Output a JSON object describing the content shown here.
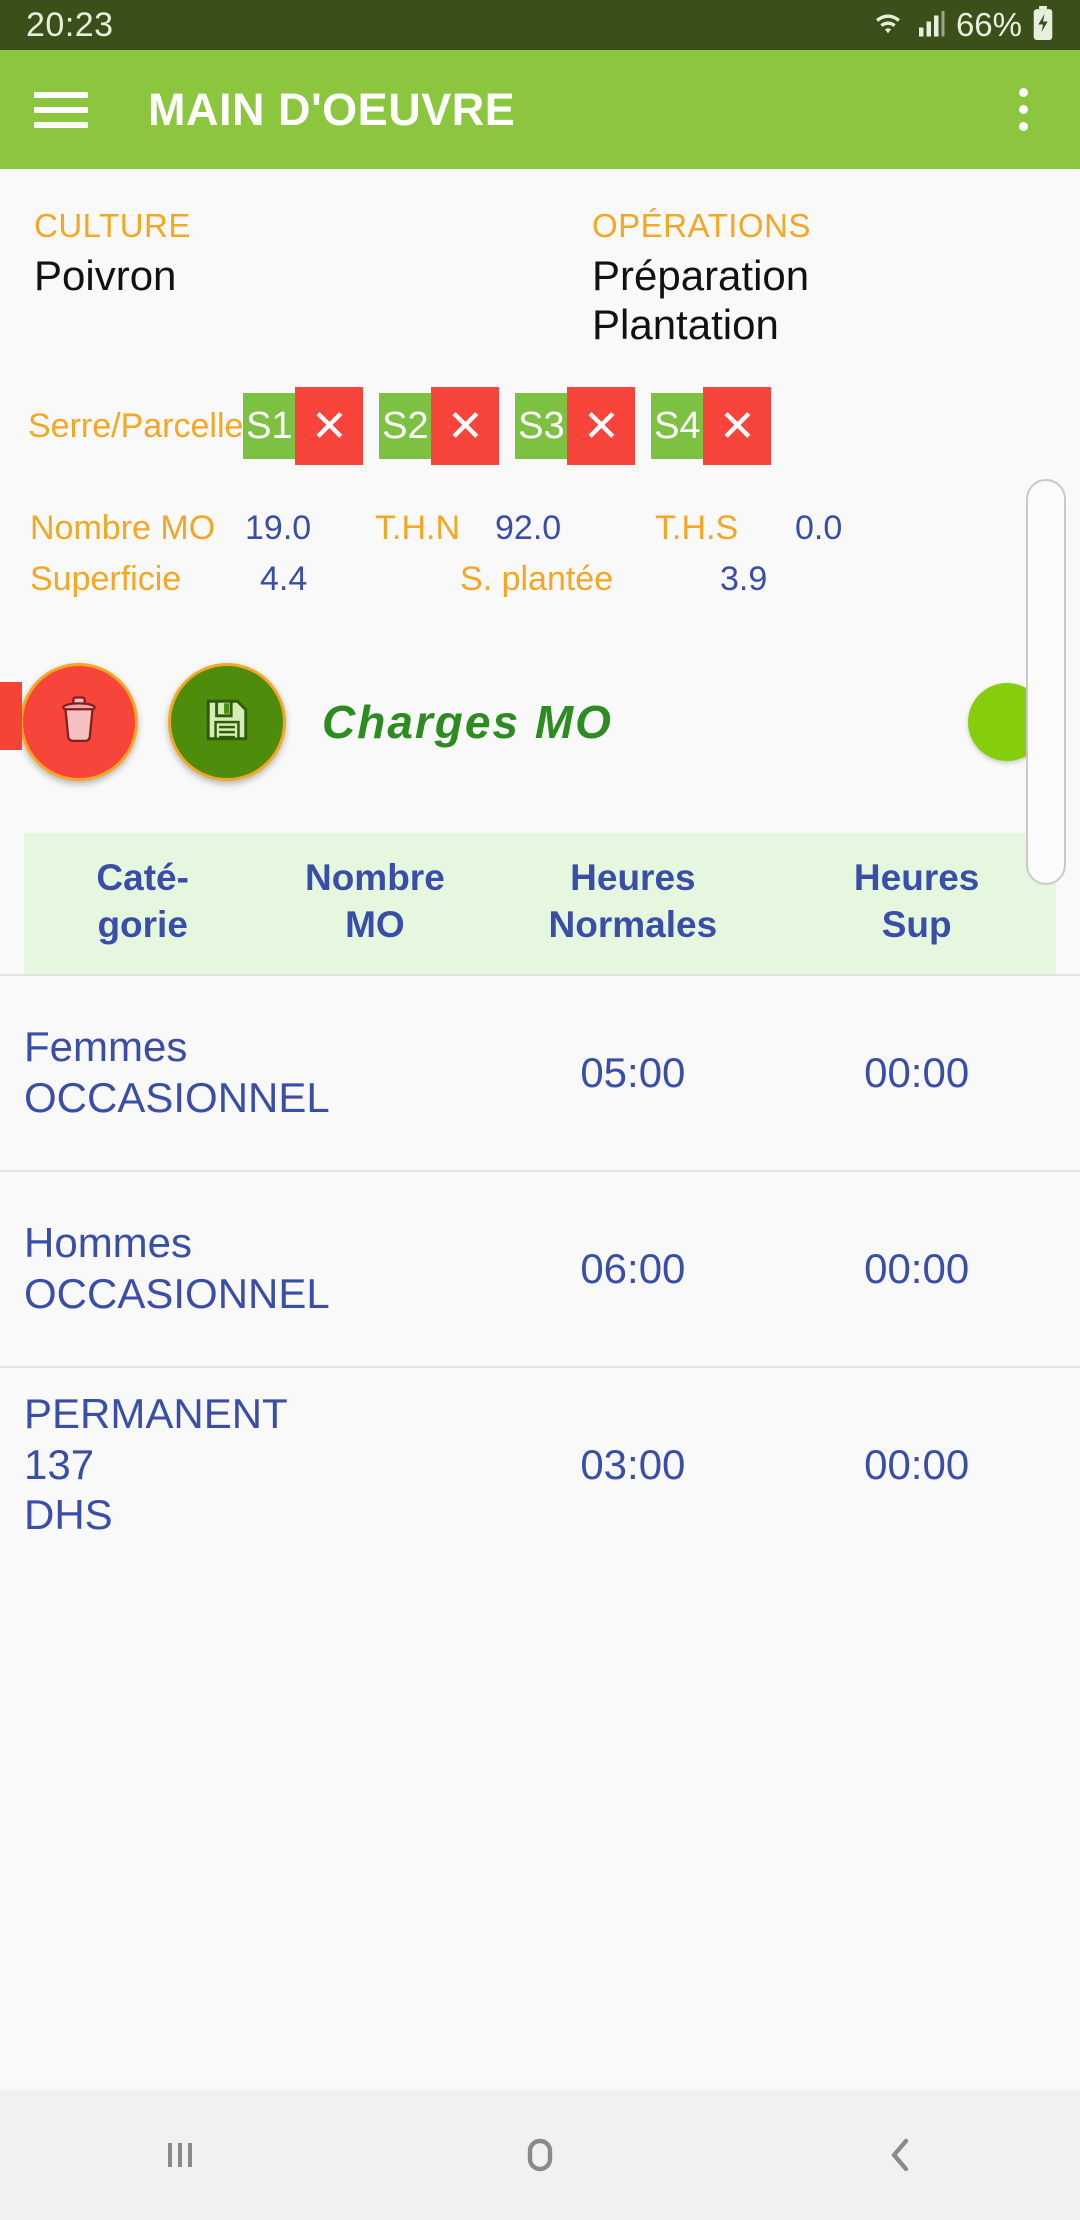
{
  "status_bar": {
    "clock": "20:23",
    "battery_percent": "66%",
    "icons": [
      "wifi-icon",
      "signal-icon",
      "battery-charging-icon"
    ]
  },
  "app_bar": {
    "title": "MAIN D'OEUVRE",
    "menu_icon": "hamburger-menu-icon",
    "overflow_icon": "kebab-menu-icon"
  },
  "info": {
    "culture_label": "CULTURE",
    "culture_value": "Poivron",
    "operations_label": "OPÉRATIONS",
    "operations_value": "Préparation\nPlantation"
  },
  "parcelle": {
    "label": "Serre/Parcelle",
    "remove_glyph": "✕",
    "chips": [
      {
        "name": "S1"
      },
      {
        "name": "S2"
      },
      {
        "name": "S3"
      },
      {
        "name": "S4"
      }
    ]
  },
  "stats": {
    "nombre_mo_label": "Nombre MO",
    "nombre_mo_value": "19.0",
    "thn_label": "T.H.N",
    "thn_value": "92.0",
    "ths_label": "T.H.S",
    "ths_value": "0.0",
    "superficie_label": "Superficie",
    "superficie_value": "4.4",
    "s_plantee_label": "S. plantée",
    "s_plantee_value": "3.9"
  },
  "actions": {
    "delete_icon": "trash-icon",
    "save_icon": "floppy-disk-save-icon",
    "section_title": "Charges MO",
    "add_icon": "add-circle-icon"
  },
  "table": {
    "headers": {
      "categorie": "Caté-\ngorie",
      "nombre_mo": "Nombre\nMO",
      "heures_normales": "Heures\nNormales",
      "heures_sup": "Heures\nSup"
    },
    "rows": [
      {
        "categorie": "Femmes\nOCCASIONNEL",
        "nombre_mo": "",
        "heures_normales": "05:00",
        "heures_sup": "00:00"
      },
      {
        "categorie": "Hommes\nOCCASIONNEL",
        "nombre_mo": "",
        "heures_normales": "06:00",
        "heures_sup": "00:00"
      },
      {
        "categorie": "PERMANENT 137\nDHS",
        "nombre_mo": "",
        "heures_normales": "03:00",
        "heures_sup": "00:00"
      }
    ]
  },
  "nav_bar": {
    "recents_icon": "recents-icon",
    "home_icon": "home-icon",
    "back_icon": "back-icon"
  },
  "colors": {
    "status_bar_bg": "#3a4f19",
    "app_bar_bg": "#8cc63e",
    "accent_orange": "#f5a623",
    "accent_blue": "#3a4ea8",
    "chip_green": "#7cc142",
    "chip_red": "#f8453c",
    "save_green": "#4e8c0c",
    "title_green": "#2e8b22",
    "add_green": "#86ce0c",
    "table_header_bg": "#e6f7e0"
  }
}
